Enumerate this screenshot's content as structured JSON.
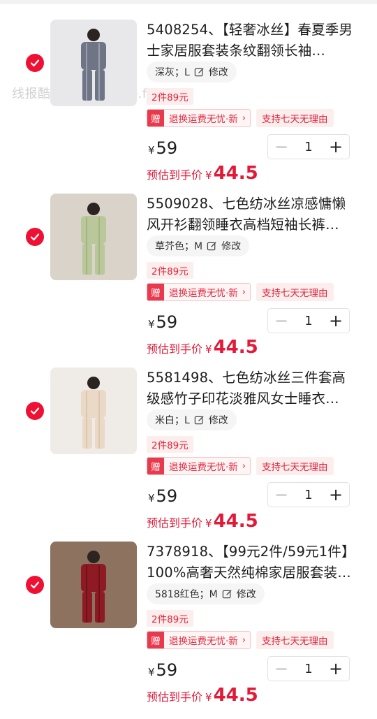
{
  "watermark": "线报酷-new.xianbao.fun",
  "items": [
    {
      "title": "5408254、【轻奢冰丝】春夏季男士家居服套装条纹翻领长袖…",
      "spec": "深灰；L",
      "edit_label": "修改",
      "promo": "2件89元",
      "gift_badge": "赠",
      "gift_text": "退换运费无忧·新",
      "chevron": "›",
      "return_tag": "支持七天无理由",
      "currency": "¥",
      "price": "59",
      "quantity": "1",
      "minus": "−",
      "plus": "+",
      "est_label": "预估到手价",
      "est_price": "44.5",
      "thumb_colors": {
        "bg": "#e8e8ea",
        "cloth": "#6f7585",
        "stripe": "#9aa0ad"
      }
    },
    {
      "title": "5509028、七色纺冰丝凉感慵懒风开衫翻领睡衣高档短袖长裤…",
      "spec": "草芥色；M",
      "edit_label": "修改",
      "promo": "2件89元",
      "gift_badge": "赠",
      "gift_text": "退换运费无忧·新",
      "chevron": "›",
      "return_tag": "支持七天无理由",
      "currency": "¥",
      "price": "59",
      "quantity": "1",
      "minus": "−",
      "plus": "+",
      "est_label": "预估到手价",
      "est_price": "44.5",
      "thumb_colors": {
        "bg": "#d9d3ca",
        "cloth": "#b9c79a",
        "stripe": "#a3b583"
      }
    },
    {
      "title": "5581498、七色纺冰丝三件套高级感竹子印花淡雅风女士睡衣…",
      "spec": "米白；L",
      "edit_label": "修改",
      "promo": "2件89元",
      "gift_badge": "赠",
      "gift_text": "退换运费无忧·新",
      "chevron": "›",
      "return_tag": "支持七天无理由",
      "currency": "¥",
      "price": "59",
      "quantity": "1",
      "minus": "−",
      "plus": "+",
      "est_label": "预估到手价",
      "est_price": "44.5",
      "thumb_colors": {
        "bg": "#efece8",
        "cloth": "#ead9c6",
        "stripe": "#dcc6ae"
      }
    },
    {
      "title": "7378918、【99元2件/59元1件】100%高奢天然纯棉家居服套装…",
      "spec": "5818红色；M",
      "edit_label": "修改",
      "promo": "2件89元",
      "gift_badge": "赠",
      "gift_text": "退换运费无忧·新",
      "chevron": "›",
      "return_tag": "支持七天无理由",
      "currency": "¥",
      "price": "59",
      "quantity": "1",
      "minus": "−",
      "plus": "+",
      "est_label": "预估到手价",
      "est_price": "44.5",
      "thumb_colors": {
        "bg": "#8d7260",
        "cloth": "#8e1a24",
        "stripe": "#6c1219"
      }
    }
  ],
  "accent": "#e21a38"
}
